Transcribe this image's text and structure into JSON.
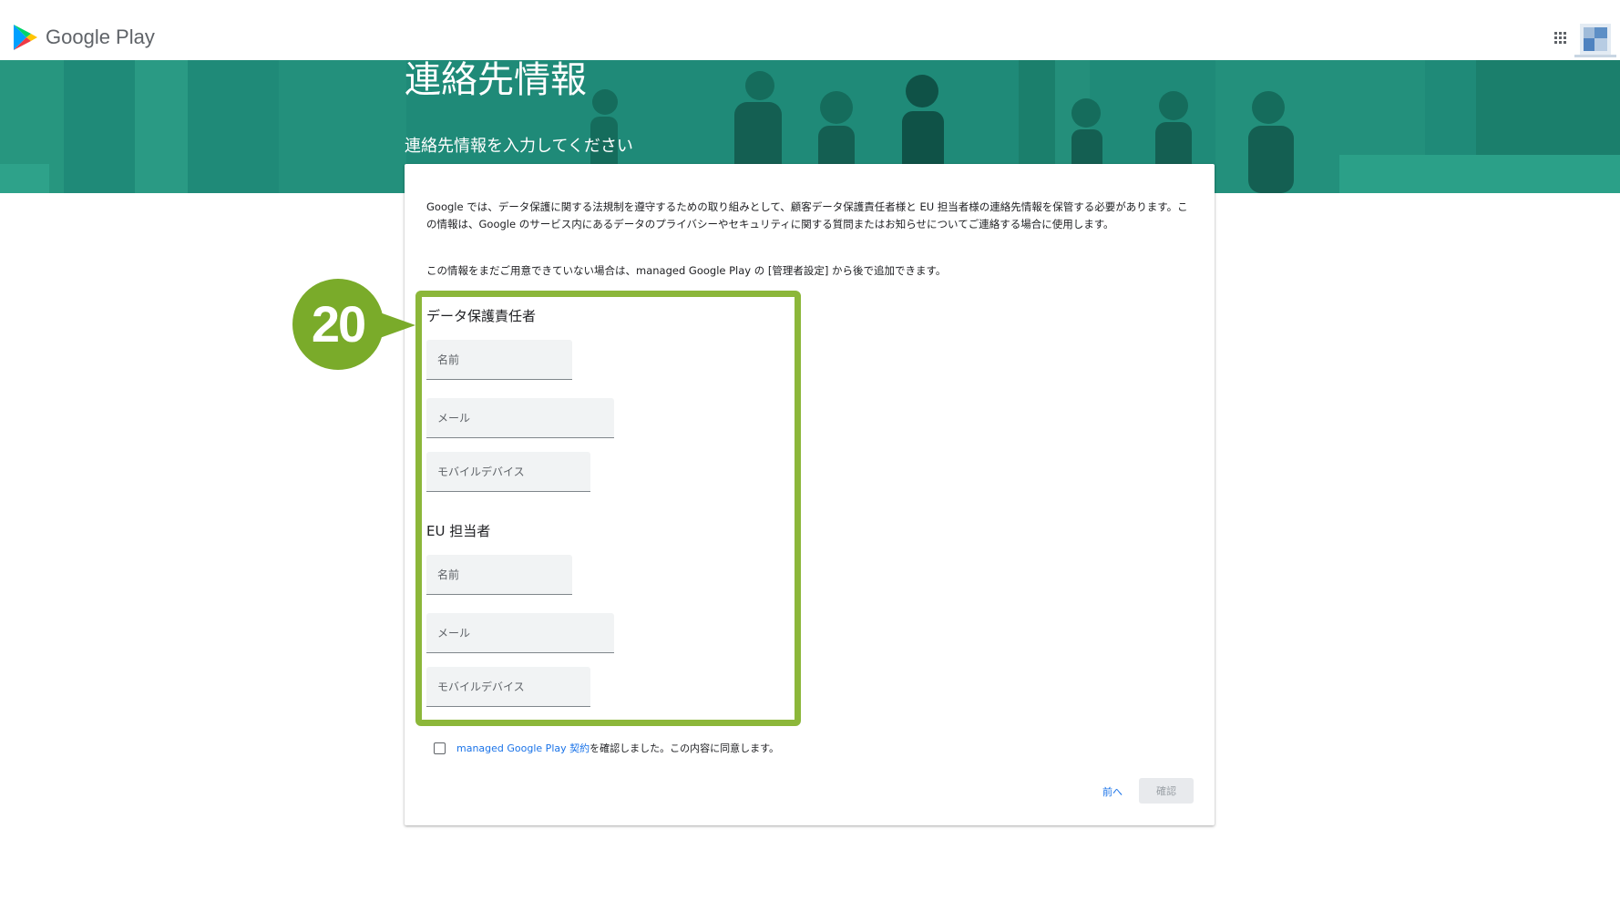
{
  "header": {
    "logo_text": "Google Play",
    "apps_icon": "apps-grid-icon",
    "avatar": "account-avatar"
  },
  "banner": {
    "title": "連絡先情報",
    "subtitle": "連絡先情報を入力してください",
    "background_color": "#1f8a78"
  },
  "card": {
    "description": "Google では、データ保護に関する法規制を遵守するための取り組みとして、顧客データ保護責任者様と EU 担当者様の連絡先情報を保管する必要があります。この情報は、Google のサービス内にあるデータのプライバシーやセキュリティに関する質問またはお知らせについてご連絡する場合に使用します。",
    "description_later": "この情報をまだご用意できていない場合は、managed Google Play の [管理者設定] から後で追加できます。",
    "dpo_section": {
      "heading": "データ保護責任者",
      "name_placeholder": "名前",
      "email_placeholder": "メール",
      "mobile_placeholder": "モバイルデバイス"
    },
    "eu_section": {
      "heading": "EU 担当者",
      "name_placeholder": "名前",
      "email_placeholder": "メール",
      "mobile_placeholder": "モバイルデバイス"
    },
    "agreement": {
      "link_text": "managed Google Play 契約",
      "suffix_text": "を確認しました。この内容に同意します。",
      "checked": false
    },
    "buttons": {
      "back_label": "前へ",
      "confirm_label": "確認"
    }
  },
  "annotation": {
    "step_number": "20",
    "accent_color": "#8cb73a"
  }
}
